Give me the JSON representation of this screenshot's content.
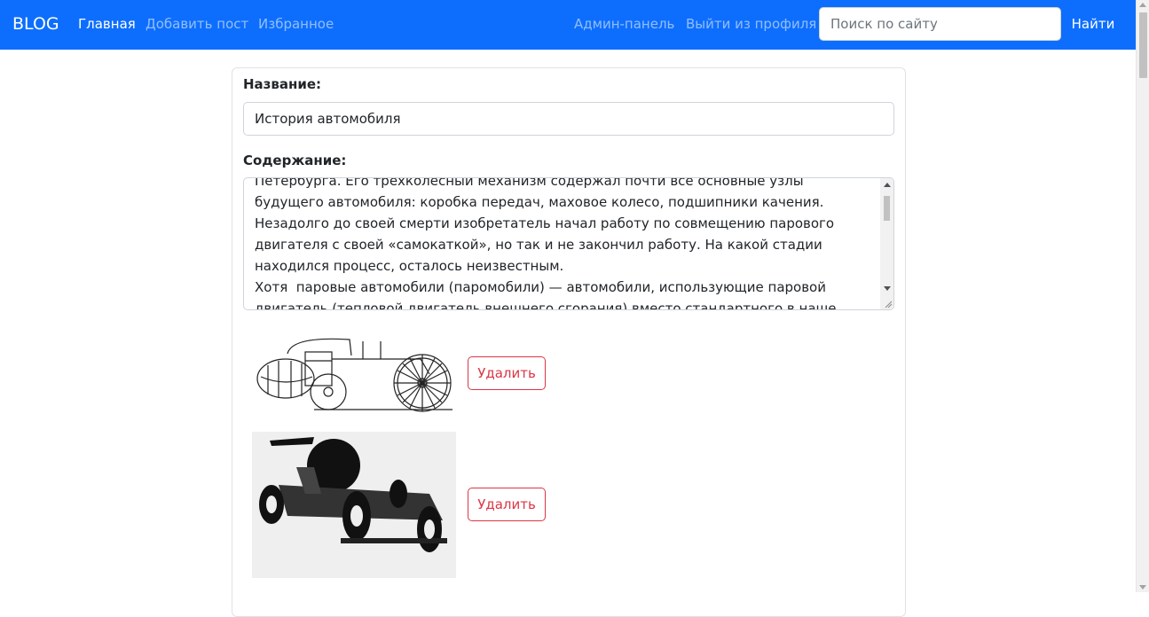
{
  "navbar": {
    "brand": "BLOG",
    "links": [
      "Главная",
      "Добавить пост",
      "Избранное"
    ],
    "right_links": [
      "Админ-панель",
      "Выйти из профиля"
    ],
    "search_placeholder": "Поиск по сайту",
    "search_button": "Найти",
    "color": "#0d6efd"
  },
  "form": {
    "title_label": "Название:",
    "title_value": "История автомобиля",
    "content_label": "Содержание:",
    "content_text": "Петербурга. Его трехколесный механизм содержал почти все основные узлы будущего автомобиля: коробка передач, маховое колесо, подшипники качения.  Незадолго до своей смерти изобретатель начал работу по совмещению парового двигателя с своей «самокаткой», но так и не закончил работу. На какой стадии находился процесс, осталось неизвестным.\nХотя  паровые автомобили (паромобили) — автомобили, использующие паровой двигатель (тепловой двигатель внешнего сгорания) вместо стандартного в наше время",
    "images": [
      {
        "delete_label": "Удалить",
        "icon": "steam-car-drawing"
      },
      {
        "delete_label": "Удалить",
        "icon": "steam-carriage-photo"
      }
    ],
    "delete_color": "#dc3545"
  }
}
